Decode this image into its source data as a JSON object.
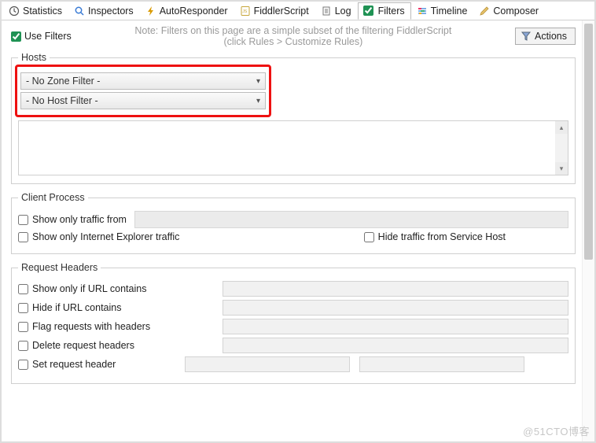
{
  "tabs": {
    "statistics": "Statistics",
    "inspectors": "Inspectors",
    "autoresponder": "AutoResponder",
    "fiddlerscript": "FiddlerScript",
    "log": "Log",
    "filters": "Filters",
    "timeline": "Timeline",
    "composer": "Composer"
  },
  "top": {
    "use_filters": "Use Filters",
    "note_line1": "Note: Filters on this page are a simple subset of the filtering FiddlerScript",
    "note_line2": "(click Rules > Customize Rules)",
    "actions": "Actions"
  },
  "hosts": {
    "legend": "Hosts",
    "zone_filter": "- No Zone Filter -",
    "host_filter": "- No Host Filter -"
  },
  "client_process": {
    "legend": "Client Process",
    "show_only_traffic_from": "Show only traffic from",
    "show_only_ie": "Show only Internet Explorer traffic",
    "hide_service_host": "Hide traffic from Service Host"
  },
  "request_headers": {
    "legend": "Request Headers",
    "show_if_url": "Show only if URL contains",
    "hide_if_url": "Hide if URL contains",
    "flag_with_headers": "Flag requests with headers",
    "delete_headers": "Delete request headers",
    "set_header": "Set request header"
  },
  "watermark": "@51CTO博客"
}
